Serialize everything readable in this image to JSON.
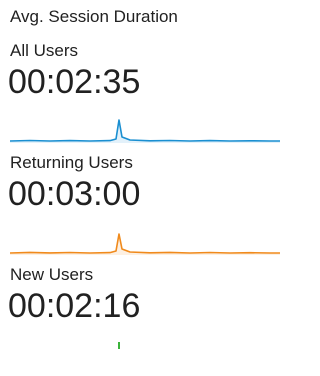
{
  "widget": {
    "title": "Avg. Session Duration"
  },
  "segments": [
    {
      "label": "All Users",
      "value": "00:02:35",
      "line_color": "#1a8fd1",
      "fill_color": "#e3f1fa"
    },
    {
      "label": "Returning Users",
      "value": "00:03:00",
      "line_color": "#f08a1c",
      "fill_color": "#fdf0e2"
    },
    {
      "label": "New Users",
      "value": "00:02:16",
      "line_color": "#3bb33b",
      "fill_color": "#e6f5e6"
    }
  ]
}
